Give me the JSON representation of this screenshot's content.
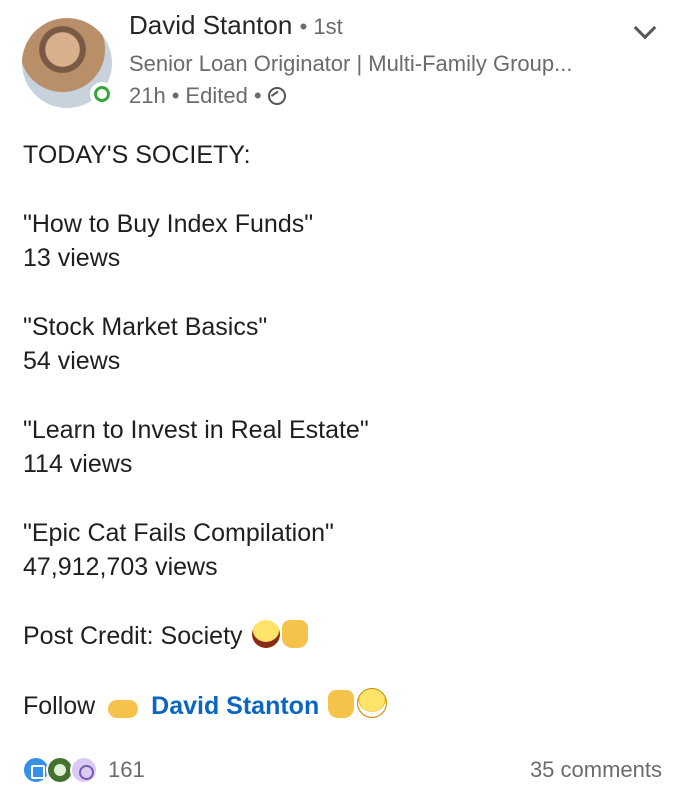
{
  "author": {
    "name": "David Stanton",
    "degree": "1st",
    "headline": "Senior Loan Originator | Multi-Family Group...",
    "time": "21h",
    "edited": "Edited",
    "visibility_icon": "globe-icon",
    "online_status": "online"
  },
  "post": {
    "intro": "TODAY'S SOCIETY:",
    "videos": [
      {
        "title": "\"How to Buy Index Funds\"",
        "views": "13 views"
      },
      {
        "title": "\"Stock Market Basics\"",
        "views": "54 views"
      },
      {
        "title": "\"Learn to Invest in Real Estate\"",
        "views": "114 views"
      },
      {
        "title": "\"Epic Cat Fails Compilation\"",
        "views": "47,912,703 views"
      }
    ],
    "credit_text": "Post Credit: Society",
    "follow_text": "Follow",
    "follow_link": "David Stanton"
  },
  "footer": {
    "reaction_count": "161",
    "comments": "35 comments",
    "reaction_icons": [
      "like-icon",
      "celebrate-icon",
      "curious-icon"
    ]
  },
  "colors": {
    "link": "#0a66c2",
    "secondary_text": "#6b6b6b",
    "online": "#3aa53a"
  }
}
